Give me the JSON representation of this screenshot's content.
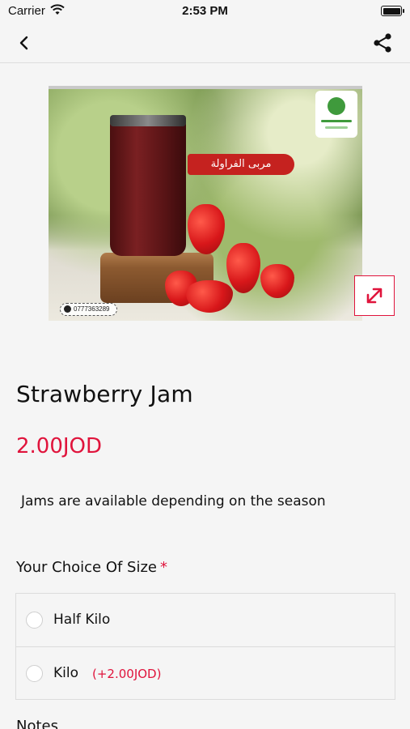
{
  "status_bar": {
    "carrier": "Carrier",
    "time": "2:53 PM"
  },
  "nav": {
    "back_icon": "chevron-left-icon",
    "share_icon": "share-icon"
  },
  "product": {
    "image_label_text": "مربى الفراولة",
    "image_phone": "0777363289",
    "title": "Strawberry Jam",
    "price": "2.00JOD",
    "description": "Jams are available depending on the season"
  },
  "size_section": {
    "heading": "Your Choice Of Size",
    "required_mark": "*",
    "options": [
      {
        "label": "Half Kilo",
        "extra": ""
      },
      {
        "label": "Kilo",
        "extra": "(+2.00JOD)"
      }
    ]
  },
  "notes": {
    "heading": "Notes"
  },
  "colors": {
    "accent": "#e0143c",
    "background": "#f5f5f5",
    "border": "#dcdcdc"
  }
}
